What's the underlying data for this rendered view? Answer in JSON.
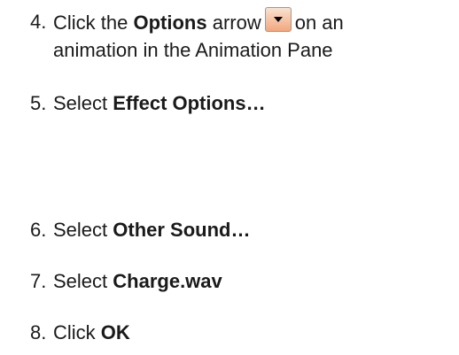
{
  "steps": [
    {
      "number": "4.",
      "line1": {
        "pre": "Click the ",
        "bold": "Options",
        "mid": " arrow",
        "post": "on an"
      },
      "line2": "animation in the Animation Pane",
      "icon": "options-arrow-icon"
    },
    {
      "number": "5.",
      "pre": "Select ",
      "bold": "Effect Options…"
    },
    {
      "number": "6.",
      "pre": "Select ",
      "bold": "Other Sound…"
    },
    {
      "number": "7.",
      "pre": "Select ",
      "bold": "Charge.wav"
    },
    {
      "number": "8.",
      "pre": "Click ",
      "bold": "OK"
    }
  ],
  "colors": {
    "text": "#1a1a1a",
    "icon_fill": "#f2a77e"
  }
}
